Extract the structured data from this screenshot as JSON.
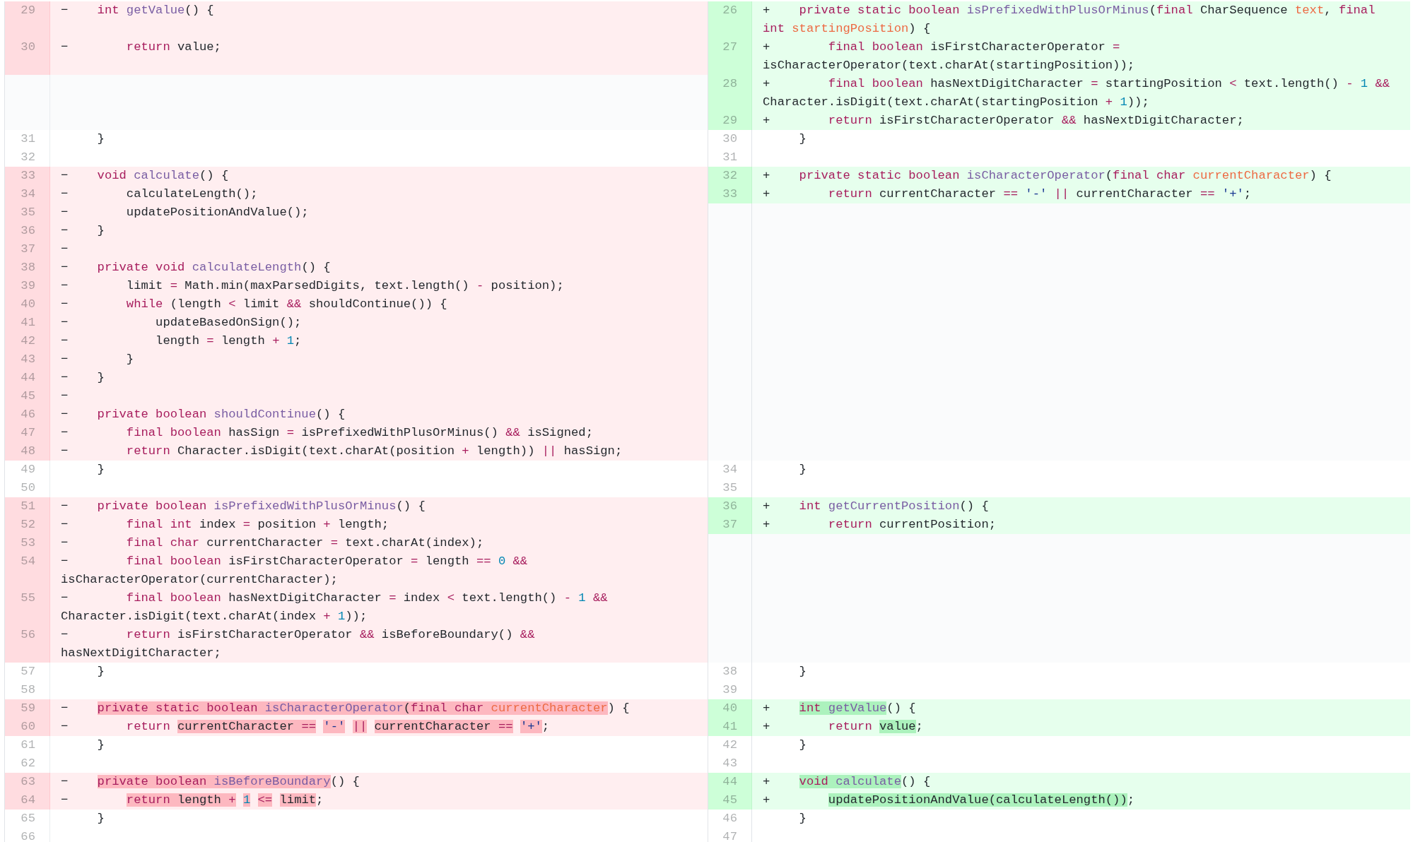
{
  "rows": [
    {
      "left": {
        "kind": "del",
        "num": "29",
        "sign": "−",
        "code": [
          {
            "kind": "keyword",
            "text": "int "
          },
          {
            "kind": "function",
            "text": "getValue"
          },
          {
            "kind": "plain",
            "text": "() {"
          }
        ]
      },
      "right": {
        "kind": "add",
        "num": "26",
        "sign": "+",
        "code": [
          {
            "kind": "keyword",
            "text": "private static boolean "
          },
          {
            "kind": "function",
            "text": "isPrefixedWithPlusOrMinus"
          },
          {
            "kind": "plain",
            "text": "("
          },
          {
            "kind": "keyword",
            "text": "final "
          },
          {
            "kind": "plain",
            "text": "CharSequence "
          },
          {
            "kind": "param",
            "text": "text"
          },
          {
            "kind": "plain",
            "text": ", "
          },
          {
            "kind": "keyword",
            "text": "final int "
          },
          {
            "kind": "param",
            "text": "startingPosition"
          },
          {
            "kind": "plain",
            "text": ") {"
          }
        ]
      }
    },
    {
      "left": {
        "kind": "del",
        "num": "30",
        "sign": "−",
        "code": [
          {
            "kind": "keyword",
            "text": "    return "
          },
          {
            "kind": "plain",
            "text": "value;"
          }
        ]
      },
      "right": {
        "kind": "add",
        "num": "27",
        "sign": "+",
        "code": [
          {
            "kind": "keyword",
            "text": "    final boolean "
          },
          {
            "kind": "plain",
            "text": "isFirstCharacterOperator "
          },
          {
            "kind": "keyword",
            "text": "="
          },
          {
            "kind": "plain",
            "text": " isCharacterOperator(text.charAt(startingPosition));"
          }
        ]
      }
    },
    {
      "left": {
        "kind": "empty"
      },
      "right": {
        "kind": "add",
        "num": "28",
        "sign": "+",
        "code": [
          {
            "kind": "keyword",
            "text": "    final boolean "
          },
          {
            "kind": "plain",
            "text": "hasNextDigitCharacter "
          },
          {
            "kind": "keyword",
            "text": "="
          },
          {
            "kind": "plain",
            "text": " startingPosition "
          },
          {
            "kind": "keyword",
            "text": "<"
          },
          {
            "kind": "plain",
            "text": " text.length() "
          },
          {
            "kind": "keyword",
            "text": "-"
          },
          {
            "kind": "number",
            "text": " 1"
          },
          {
            "kind": "keyword",
            "text": " &&"
          },
          {
            "kind": "plain",
            "text": " Character.isDigit(text.charAt(startingPosition "
          },
          {
            "kind": "keyword",
            "text": "+"
          },
          {
            "kind": "number",
            "text": " 1"
          },
          {
            "kind": "plain",
            "text": "));"
          }
        ]
      }
    },
    {
      "left": {
        "kind": "empty"
      },
      "right": {
        "kind": "add",
        "num": "29",
        "sign": "+",
        "code": [
          {
            "kind": "keyword",
            "text": "    return "
          },
          {
            "kind": "plain",
            "text": "isFirstCharacterOperator "
          },
          {
            "kind": "keyword",
            "text": "&&"
          },
          {
            "kind": "plain",
            "text": " hasNextDigitCharacter;"
          }
        ]
      }
    },
    {
      "left": {
        "kind": "ctx",
        "num": "31",
        "code": [
          {
            "kind": "plain",
            "text": "}"
          }
        ]
      },
      "right": {
        "kind": "ctx",
        "num": "30",
        "code": [
          {
            "kind": "plain",
            "text": "}"
          }
        ]
      }
    },
    {
      "left": {
        "kind": "ctx",
        "num": "32"
      },
      "right": {
        "kind": "ctx",
        "num": "31"
      }
    },
    {
      "left": {
        "kind": "del",
        "num": "33",
        "sign": "−",
        "code": [
          {
            "kind": "keyword",
            "text": "void "
          },
          {
            "kind": "function",
            "text": "calculate"
          },
          {
            "kind": "plain",
            "text": "() {"
          }
        ]
      },
      "right": {
        "kind": "add",
        "num": "32",
        "sign": "+",
        "code": [
          {
            "kind": "keyword",
            "text": "private static boolean "
          },
          {
            "kind": "function",
            "text": "isCharacterOperator"
          },
          {
            "kind": "plain",
            "text": "("
          },
          {
            "kind": "keyword",
            "text": "final char "
          },
          {
            "kind": "param",
            "text": "currentCharacter"
          },
          {
            "kind": "plain",
            "text": ") {"
          }
        ]
      }
    },
    {
      "left": {
        "kind": "del",
        "num": "34",
        "sign": "−",
        "code": [
          {
            "kind": "plain",
            "text": "    calculateLength();"
          }
        ]
      },
      "right": {
        "kind": "add",
        "num": "33",
        "sign": "+",
        "code": [
          {
            "kind": "keyword",
            "text": "    return "
          },
          {
            "kind": "plain",
            "text": "currentCharacter "
          },
          {
            "kind": "keyword",
            "text": "=="
          },
          {
            "kind": "string",
            "text": " '-'"
          },
          {
            "kind": "keyword",
            "text": " ||"
          },
          {
            "kind": "plain",
            "text": " currentCharacter "
          },
          {
            "kind": "keyword",
            "text": "=="
          },
          {
            "kind": "string",
            "text": " '+'"
          },
          {
            "kind": "plain",
            "text": ";"
          }
        ]
      }
    },
    {
      "left": {
        "kind": "del",
        "num": "35",
        "sign": "−",
        "code": [
          {
            "kind": "plain",
            "text": "    updatePositionAndValue();"
          }
        ]
      },
      "right": {
        "kind": "empty"
      }
    },
    {
      "left": {
        "kind": "del",
        "num": "36",
        "sign": "−",
        "code": [
          {
            "kind": "plain",
            "text": "}"
          }
        ]
      },
      "right": {
        "kind": "empty"
      }
    },
    {
      "left": {
        "kind": "del",
        "num": "37",
        "sign": "−"
      },
      "right": {
        "kind": "empty"
      }
    },
    {
      "left": {
        "kind": "del",
        "num": "38",
        "sign": "−",
        "code": [
          {
            "kind": "keyword",
            "text": "private void "
          },
          {
            "kind": "function",
            "text": "calculateLength"
          },
          {
            "kind": "plain",
            "text": "() {"
          }
        ]
      },
      "right": {
        "kind": "empty"
      }
    },
    {
      "left": {
        "kind": "del",
        "num": "39",
        "sign": "−",
        "code": [
          {
            "kind": "plain",
            "text": "    limit "
          },
          {
            "kind": "keyword",
            "text": "="
          },
          {
            "kind": "plain",
            "text": " Math.min(maxParsedDigits, text.length() "
          },
          {
            "kind": "keyword",
            "text": "-"
          },
          {
            "kind": "plain",
            "text": " position);"
          }
        ]
      },
      "right": {
        "kind": "empty"
      }
    },
    {
      "left": {
        "kind": "del",
        "num": "40",
        "sign": "−",
        "code": [
          {
            "kind": "keyword",
            "text": "    while"
          },
          {
            "kind": "plain",
            "text": " (length "
          },
          {
            "kind": "keyword",
            "text": "<"
          },
          {
            "kind": "plain",
            "text": " limit "
          },
          {
            "kind": "keyword",
            "text": "&&"
          },
          {
            "kind": "plain",
            "text": " shouldContinue()) {"
          }
        ]
      },
      "right": {
        "kind": "empty"
      }
    },
    {
      "left": {
        "kind": "del",
        "num": "41",
        "sign": "−",
        "code": [
          {
            "kind": "plain",
            "text": "        updateBasedOnSign();"
          }
        ]
      },
      "right": {
        "kind": "empty"
      }
    },
    {
      "left": {
        "kind": "del",
        "num": "42",
        "sign": "−",
        "code": [
          {
            "kind": "plain",
            "text": "        length "
          },
          {
            "kind": "keyword",
            "text": "="
          },
          {
            "kind": "plain",
            "text": " length "
          },
          {
            "kind": "keyword",
            "text": "+"
          },
          {
            "kind": "number",
            "text": " 1"
          },
          {
            "kind": "plain",
            "text": ";"
          }
        ]
      },
      "right": {
        "kind": "empty"
      }
    },
    {
      "left": {
        "kind": "del",
        "num": "43",
        "sign": "−",
        "code": [
          {
            "kind": "plain",
            "text": "    }"
          }
        ]
      },
      "right": {
        "kind": "empty"
      }
    },
    {
      "left": {
        "kind": "del",
        "num": "44",
        "sign": "−",
        "code": [
          {
            "kind": "plain",
            "text": "}"
          }
        ]
      },
      "right": {
        "kind": "empty"
      }
    },
    {
      "left": {
        "kind": "del",
        "num": "45",
        "sign": "−"
      },
      "right": {
        "kind": "empty"
      }
    },
    {
      "left": {
        "kind": "del",
        "num": "46",
        "sign": "−",
        "code": [
          {
            "kind": "keyword",
            "text": "private boolean "
          },
          {
            "kind": "function",
            "text": "shouldContinue"
          },
          {
            "kind": "plain",
            "text": "() {"
          }
        ]
      },
      "right": {
        "kind": "empty"
      }
    },
    {
      "left": {
        "kind": "del",
        "num": "47",
        "sign": "−",
        "code": [
          {
            "kind": "keyword",
            "text": "    final boolean "
          },
          {
            "kind": "plain",
            "text": "hasSign "
          },
          {
            "kind": "keyword",
            "text": "="
          },
          {
            "kind": "plain",
            "text": " isPrefixedWithPlusOrMinus() "
          },
          {
            "kind": "keyword",
            "text": "&&"
          },
          {
            "kind": "plain",
            "text": " isSigned;"
          }
        ]
      },
      "right": {
        "kind": "empty"
      }
    },
    {
      "left": {
        "kind": "del",
        "num": "48",
        "sign": "−",
        "code": [
          {
            "kind": "keyword",
            "text": "    return "
          },
          {
            "kind": "plain",
            "text": "Character.isDigit(text.charAt(position "
          },
          {
            "kind": "keyword",
            "text": "+"
          },
          {
            "kind": "plain",
            "text": " length)) "
          },
          {
            "kind": "keyword",
            "text": "||"
          },
          {
            "kind": "plain",
            "text": " hasSign;"
          }
        ]
      },
      "right": {
        "kind": "empty"
      }
    },
    {
      "left": {
        "kind": "ctx",
        "num": "49",
        "code": [
          {
            "kind": "plain",
            "text": "}"
          }
        ]
      },
      "right": {
        "kind": "ctx",
        "num": "34",
        "code": [
          {
            "kind": "plain",
            "text": "}"
          }
        ]
      }
    },
    {
      "left": {
        "kind": "ctx",
        "num": "50"
      },
      "right": {
        "kind": "ctx",
        "num": "35"
      }
    },
    {
      "left": {
        "kind": "del",
        "num": "51",
        "sign": "−",
        "code": [
          {
            "kind": "keyword",
            "text": "private boolean "
          },
          {
            "kind": "function",
            "text": "isPrefixedWithPlusOrMinus"
          },
          {
            "kind": "plain",
            "text": "() {"
          }
        ]
      },
      "right": {
        "kind": "add",
        "num": "36",
        "sign": "+",
        "code": [
          {
            "kind": "keyword",
            "text": "int "
          },
          {
            "kind": "function",
            "text": "getCurrentPosition"
          },
          {
            "kind": "plain",
            "text": "() {"
          }
        ]
      }
    },
    {
      "left": {
        "kind": "del",
        "num": "52",
        "sign": "−",
        "code": [
          {
            "kind": "keyword",
            "text": "    final int "
          },
          {
            "kind": "plain",
            "text": "index "
          },
          {
            "kind": "keyword",
            "text": "="
          },
          {
            "kind": "plain",
            "text": " position "
          },
          {
            "kind": "keyword",
            "text": "+"
          },
          {
            "kind": "plain",
            "text": " length;"
          }
        ]
      },
      "right": {
        "kind": "add",
        "num": "37",
        "sign": "+",
        "code": [
          {
            "kind": "keyword",
            "text": "    return "
          },
          {
            "kind": "plain",
            "text": "currentPosition;"
          }
        ]
      }
    },
    {
      "left": {
        "kind": "del",
        "num": "53",
        "sign": "−",
        "code": [
          {
            "kind": "keyword",
            "text": "    final char "
          },
          {
            "kind": "plain",
            "text": "currentCharacter "
          },
          {
            "kind": "keyword",
            "text": "="
          },
          {
            "kind": "plain",
            "text": " text.charAt(index);"
          }
        ]
      },
      "right": {
        "kind": "empty"
      }
    },
    {
      "left": {
        "kind": "del",
        "num": "54",
        "sign": "−",
        "code": [
          {
            "kind": "keyword",
            "text": "    final boolean "
          },
          {
            "kind": "plain",
            "text": "isFirstCharacterOperator "
          },
          {
            "kind": "keyword",
            "text": "="
          },
          {
            "kind": "plain",
            "text": " length "
          },
          {
            "kind": "keyword",
            "text": "=="
          },
          {
            "kind": "number",
            "text": " 0"
          },
          {
            "kind": "keyword",
            "text": " &&"
          },
          {
            "kind": "plain",
            "text": " isCharacterOperator(currentCharacter);"
          }
        ]
      },
      "right": {
        "kind": "empty"
      }
    },
    {
      "left": {
        "kind": "del",
        "num": "55",
        "sign": "−",
        "code": [
          {
            "kind": "keyword",
            "text": "    final boolean "
          },
          {
            "kind": "plain",
            "text": "hasNextDigitCharacter "
          },
          {
            "kind": "keyword",
            "text": "="
          },
          {
            "kind": "plain",
            "text": " index "
          },
          {
            "kind": "keyword",
            "text": "<"
          },
          {
            "kind": "plain",
            "text": " text.length() "
          },
          {
            "kind": "keyword",
            "text": "-"
          },
          {
            "kind": "number",
            "text": " 1"
          },
          {
            "kind": "keyword",
            "text": " &&"
          },
          {
            "kind": "plain",
            "text": " Character.isDigit(text.charAt(index "
          },
          {
            "kind": "keyword",
            "text": "+"
          },
          {
            "kind": "number",
            "text": " 1"
          },
          {
            "kind": "plain",
            "text": "));"
          }
        ]
      },
      "right": {
        "kind": "empty"
      }
    },
    {
      "left": {
        "kind": "del",
        "num": "56",
        "sign": "−",
        "code": [
          {
            "kind": "keyword",
            "text": "    return "
          },
          {
            "kind": "plain",
            "text": "isFirstCharacterOperator "
          },
          {
            "kind": "keyword",
            "text": "&&"
          },
          {
            "kind": "plain",
            "text": " isBeforeBoundary() "
          },
          {
            "kind": "keyword",
            "text": "&&"
          },
          {
            "kind": "plain",
            "text": " hasNextDigitCharacter;"
          }
        ]
      },
      "right": {
        "kind": "empty"
      }
    },
    {
      "left": {
        "kind": "ctx",
        "num": "57",
        "code": [
          {
            "kind": "plain",
            "text": "}"
          }
        ]
      },
      "right": {
        "kind": "ctx",
        "num": "38",
        "code": [
          {
            "kind": "plain",
            "text": "}"
          }
        ]
      }
    },
    {
      "left": {
        "kind": "ctx",
        "num": "58"
      },
      "right": {
        "kind": "ctx",
        "num": "39"
      }
    },
    {
      "left": {
        "kind": "del",
        "num": "59",
        "sign": "−",
        "code": [
          {
            "kind": "keyword",
            "text": "private static boolean ",
            "changed": true
          },
          {
            "kind": "function",
            "text": "isCharacterOperator",
            "changed": true
          },
          {
            "kind": "plain",
            "text": "(",
            "changed": true
          },
          {
            "kind": "keyword",
            "text": "final char ",
            "changed": true
          },
          {
            "kind": "param",
            "text": "currentCharacter",
            "changed": true
          },
          {
            "kind": "plain",
            "text": ") {"
          }
        ]
      },
      "right": {
        "kind": "add",
        "num": "40",
        "sign": "+",
        "code": [
          {
            "kind": "keyword",
            "text": "int ",
            "changed": true
          },
          {
            "kind": "function",
            "text": "getValue",
            "changed": true
          },
          {
            "kind": "plain",
            "text": "() {"
          }
        ]
      }
    },
    {
      "left": {
        "kind": "del",
        "num": "60",
        "sign": "−",
        "code": [
          {
            "kind": "keyword",
            "text": "    return "
          },
          {
            "kind": "plain",
            "text": "currentCharacter ",
            "changed": true
          },
          {
            "kind": "keyword",
            "text": "==",
            "changed": true
          },
          {
            "kind": "string",
            "text": " '-'",
            "changed": true
          },
          {
            "kind": "keyword",
            "text": " ||",
            "changed": true
          },
          {
            "kind": "plain",
            "text": " currentCharacter ",
            "changed": true
          },
          {
            "kind": "keyword",
            "text": "==",
            "changed": true
          },
          {
            "kind": "string",
            "text": " '+'",
            "changed": true
          },
          {
            "kind": "plain",
            "text": ";"
          }
        ]
      },
      "right": {
        "kind": "add",
        "num": "41",
        "sign": "+",
        "code": [
          {
            "kind": "keyword",
            "text": "    return "
          },
          {
            "kind": "plain",
            "text": "value",
            "changed": true
          },
          {
            "kind": "plain",
            "text": ";"
          }
        ]
      }
    },
    {
      "left": {
        "kind": "ctx",
        "num": "61",
        "code": [
          {
            "kind": "plain",
            "text": "}"
          }
        ]
      },
      "right": {
        "kind": "ctx",
        "num": "42",
        "code": [
          {
            "kind": "plain",
            "text": "}"
          }
        ]
      }
    },
    {
      "left": {
        "kind": "ctx",
        "num": "62"
      },
      "right": {
        "kind": "ctx",
        "num": "43"
      }
    },
    {
      "left": {
        "kind": "del",
        "num": "63",
        "sign": "−",
        "code": [
          {
            "kind": "keyword",
            "text": "private boolean ",
            "changed": true
          },
          {
            "kind": "function",
            "text": "isBeforeBoundary",
            "changed": true
          },
          {
            "kind": "plain",
            "text": "() {"
          }
        ]
      },
      "right": {
        "kind": "add",
        "num": "44",
        "sign": "+",
        "code": [
          {
            "kind": "keyword",
            "text": "void ",
            "changed": true
          },
          {
            "kind": "function",
            "text": "calculate",
            "changed": true
          },
          {
            "kind": "plain",
            "text": "() {"
          }
        ]
      }
    },
    {
      "left": {
        "kind": "del",
        "num": "64",
        "sign": "−",
        "code": [
          {
            "kind": "keyword",
            "text": "    return ",
            "changed": true
          },
          {
            "kind": "plain",
            "text": "length ",
            "changed": true
          },
          {
            "kind": "keyword",
            "text": "+",
            "changed": true
          },
          {
            "kind": "number",
            "text": " 1",
            "changed": true
          },
          {
            "kind": "keyword",
            "text": " <=",
            "changed": true
          },
          {
            "kind": "plain",
            "text": " limit",
            "changed": true
          },
          {
            "kind": "plain",
            "text": ";"
          }
        ]
      },
      "right": {
        "kind": "add",
        "num": "45",
        "sign": "+",
        "code": [
          {
            "kind": "plain",
            "text": "    updatePositionAndValue(calculateLength())",
            "changed": true
          },
          {
            "kind": "plain",
            "text": ";"
          }
        ]
      }
    },
    {
      "left": {
        "kind": "ctx",
        "num": "65",
        "code": [
          {
            "kind": "plain",
            "text": "}"
          }
        ]
      },
      "right": {
        "kind": "ctx",
        "num": "46",
        "code": [
          {
            "kind": "plain",
            "text": "}"
          }
        ]
      }
    },
    {
      "left": {
        "kind": "ctx",
        "num": "66"
      },
      "right": {
        "kind": "ctx",
        "num": "47"
      }
    }
  ]
}
